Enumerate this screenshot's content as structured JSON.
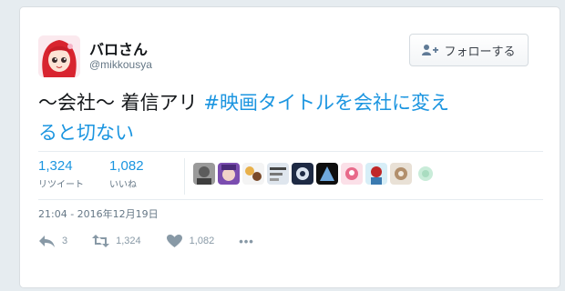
{
  "user": {
    "name": "バロさん",
    "handle": "@mikkousya"
  },
  "follow_button": {
    "label": "フォローする",
    "icon": "add-user-icon"
  },
  "tweet": {
    "text_plain": "〜会社〜 着信アリ ",
    "hashtag_part1": "#映画タイトルを会社に変え",
    "hashtag_part2": "ると切ない"
  },
  "stats": {
    "retweets": {
      "count": "1,324",
      "label": "リツイート"
    },
    "likes": {
      "count": "1,082",
      "label": "いいね"
    }
  },
  "liker_count": 10,
  "timestamp": "21:04 - 2016年12月19日",
  "actions": {
    "reply": {
      "count": "3",
      "icon": "reply-icon"
    },
    "retweet": {
      "count": "1,324",
      "icon": "retweet-icon"
    },
    "like": {
      "count": "1,082",
      "icon": "heart-icon"
    },
    "more": {
      "label": "•••",
      "icon": "more-icon"
    }
  },
  "colors": {
    "link": "#1b95e0",
    "muted": "#657786",
    "action": "#8899a6",
    "background": "#e6ecf0"
  }
}
